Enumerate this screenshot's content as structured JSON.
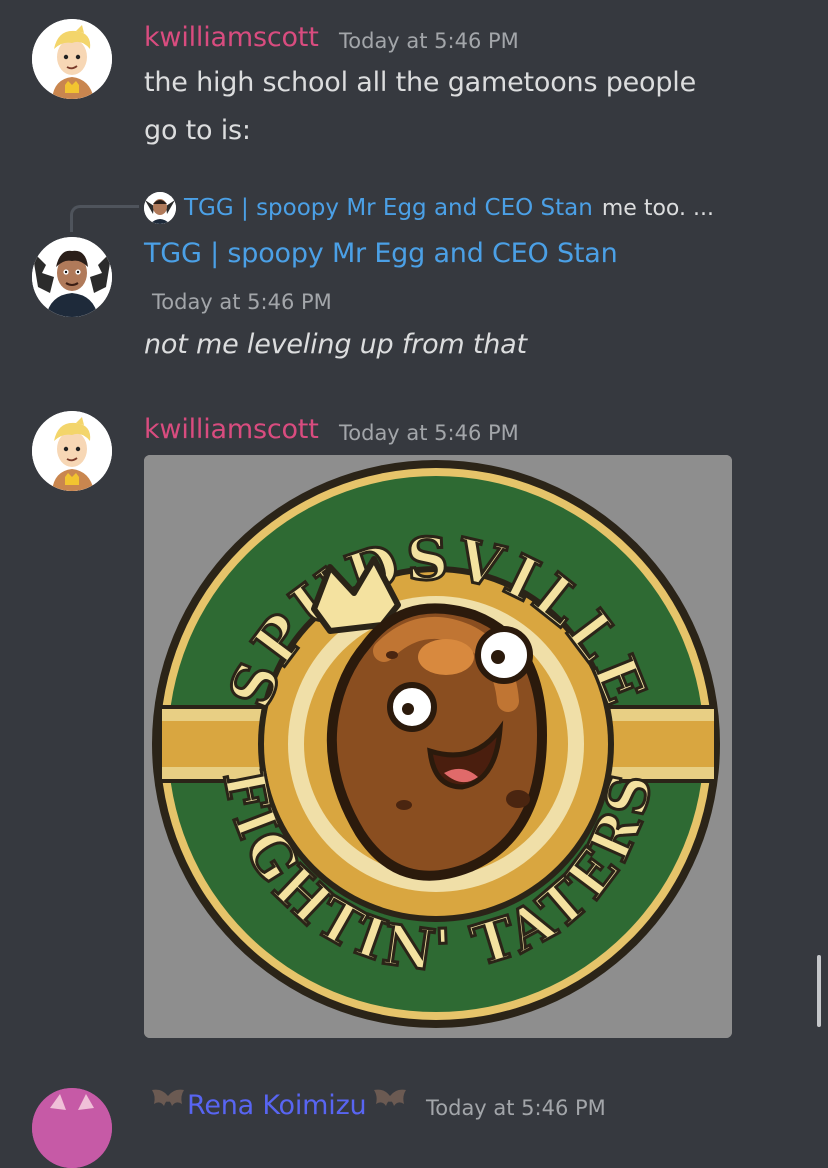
{
  "messages": [
    {
      "username": "kwilliamscott",
      "username_color": "#d94c7f",
      "timestamp": "Today at 5:46 PM",
      "lines": [
        "the high school all the gametoons people",
        "go to is:"
      ]
    },
    {
      "reply": {
        "name": "TGG | spoopy Mr Egg and CEO Stan",
        "text": "me too. ..."
      },
      "username": "TGG | spoopy Mr Egg and CEO Stan",
      "username_color": "#4ba0e6",
      "timestamp": "Today at 5:46 PM",
      "text": "not me leveling up from that"
    },
    {
      "username": "kwilliamscott",
      "username_color": "#d94c7f",
      "timestamp": "Today at 5:46 PM",
      "attachment": {
        "arc_top": "SPUDSVILLE",
        "arc_bottom": "FIGHTIN' TATERS"
      }
    },
    {
      "username": "Rena Koimizu",
      "username_color": "#5865f2",
      "timestamp": "Today at 5:46 PM"
    }
  ],
  "icons": {
    "avatar_cartoon": "cartoon-boy-avatar",
    "avatar_photo": "bat-wing-avatar",
    "bat_emoji": "bat-icon"
  },
  "colors": {
    "background": "#36393f",
    "timestamp": "#a3a6aa",
    "badge_green": "#2e6a33",
    "badge_gold": "#d9a640"
  }
}
